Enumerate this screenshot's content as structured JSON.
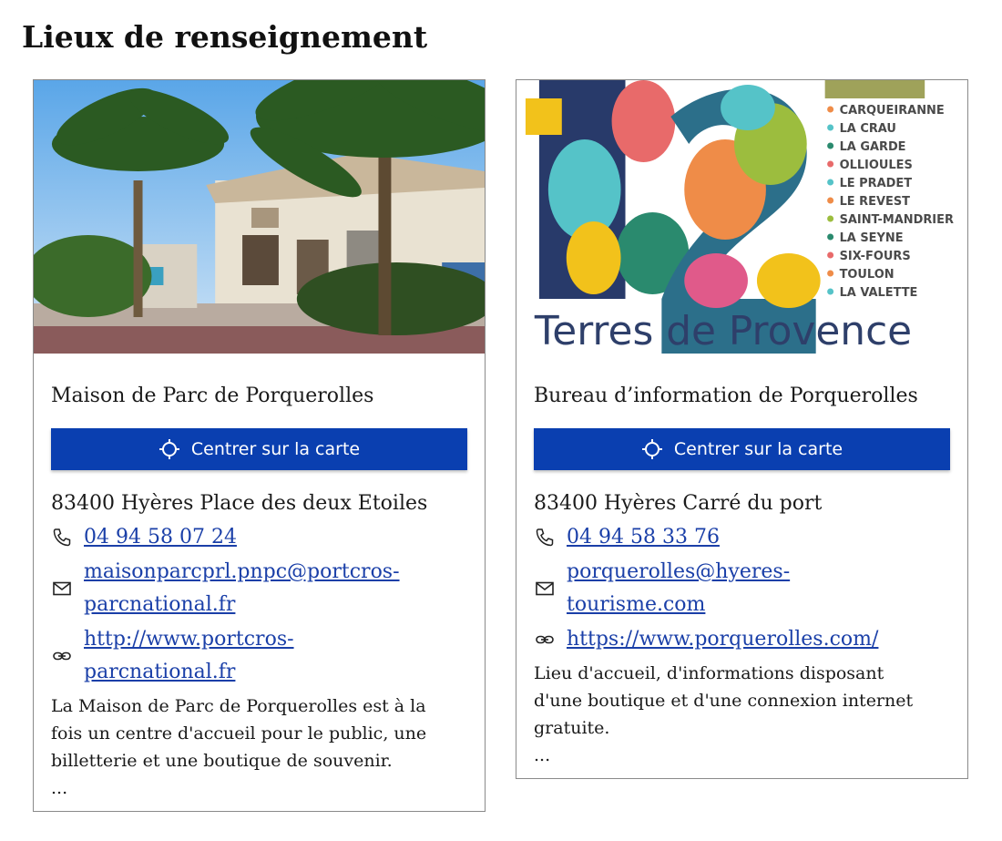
{
  "page": {
    "title": "Lieux de renseignement"
  },
  "cards": [
    {
      "name": "Maison de Parc de Porquerolles",
      "button_label": "Centrer sur la carte",
      "address": "83400 Hyères Place des deux Etoiles",
      "phone": "04 94 58 07 24",
      "email_line1": "maisonparcprl.pnpc@portcros-",
      "email_line2": "parcnational.fr",
      "website_line1": "http://www.portcros-",
      "website_line2": "parcnational.fr",
      "description_line1": "La Maison de Parc de Porquerolles est à la",
      "description_line2": "fois un centre d'accueil pour le public, une",
      "description_line3": "billetterie et une boutique de souvenir.",
      "ellipsis": "..."
    },
    {
      "name": "Bureau d’information de Porquerolles",
      "button_label": "Centrer sur la carte",
      "address": "83400 Hyères Carré du port",
      "phone": "04 94 58 33 76",
      "email_line1": "porquerolles@hyeres-",
      "email_line2": "tourisme.com",
      "website_line1": "https://www.porquerolles.com/",
      "description_line1": "Lieu d'accueil, d'informations disposant",
      "description_line2": "d'une boutique et d'une connexion internet",
      "description_line3": "gratuite.",
      "ellipsis": "...",
      "poster": {
        "number": "12",
        "brand": "Terres de Provence",
        "towns": [
          "CARQUEIRANNE",
          "LA CRAU",
          "LA GARDE",
          "OLLIOULES",
          "LE PRADET",
          "LE REVEST",
          "SAINT-MANDRIER",
          "LA SEYNE",
          "SIX-FOURS",
          "TOULON",
          "LA VALETTE"
        ]
      }
    }
  ],
  "colors": {
    "button": "#0a3fb0",
    "link": "#1a3fa8"
  },
  "icons": {
    "button": "crosshair-icon",
    "phone": "phone-icon",
    "email": "mail-icon",
    "website": "link-icon"
  }
}
